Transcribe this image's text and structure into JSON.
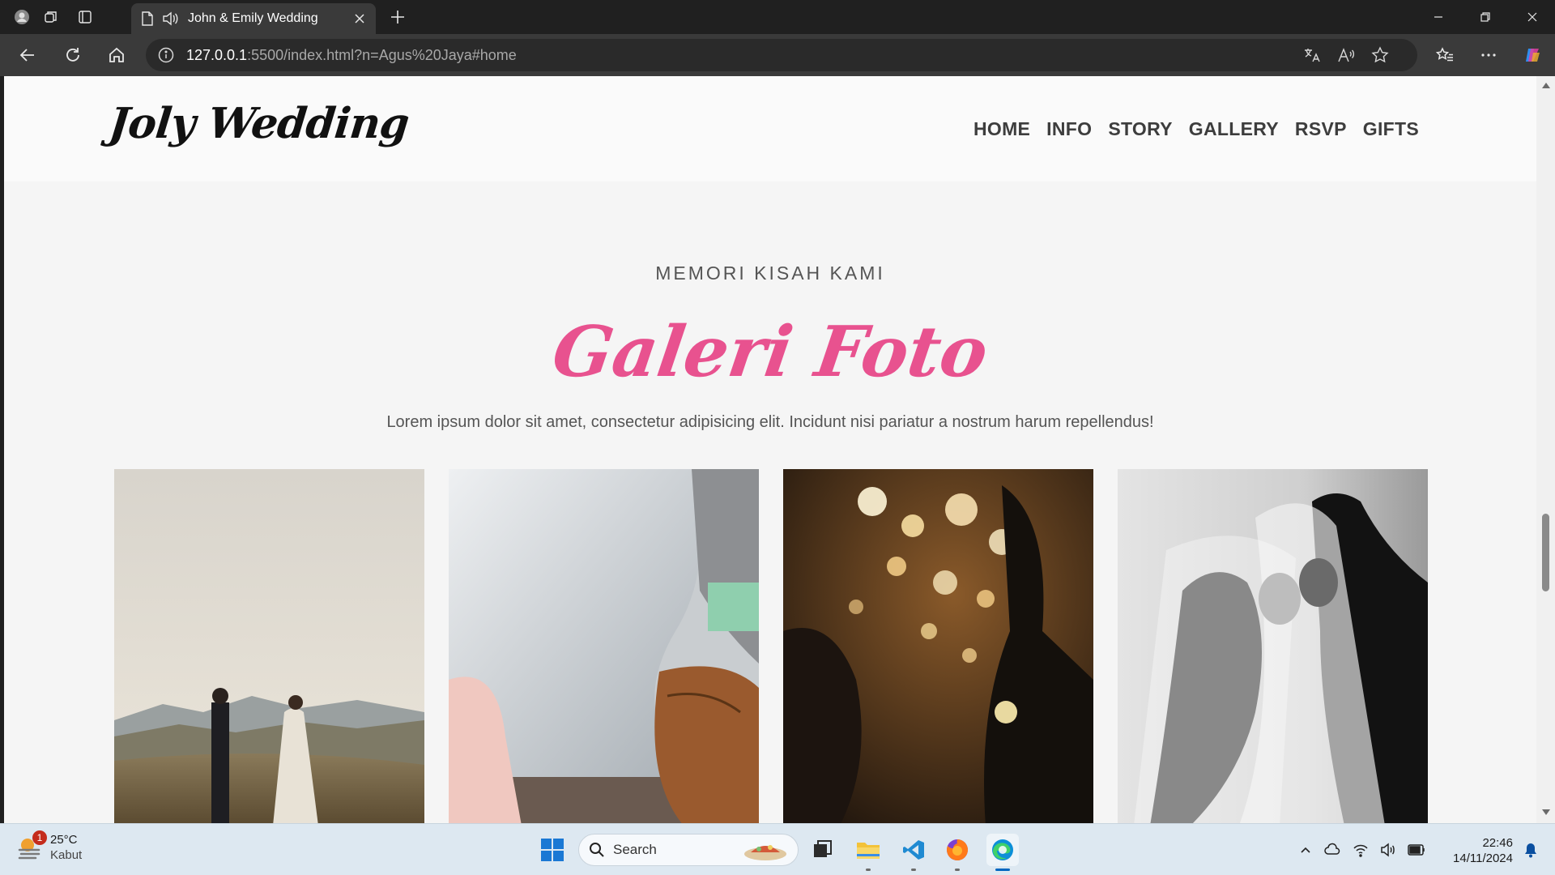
{
  "browser": {
    "tab": {
      "title": "John & Emily Wedding"
    },
    "address": {
      "host": "127.0.0.1",
      "path": ":5500/index.html?n=Agus%20Jaya#home"
    }
  },
  "site": {
    "brand": "Joly Wedding",
    "nav": [
      "HOME",
      "INFO",
      "STORY",
      "GALLERY",
      "RSVP",
      "GIFTS"
    ],
    "gallery": {
      "eyebrow": "MEMORI KISAH KAMI",
      "title": "Galeri Foto",
      "description": "Lorem ipsum dolor sit amet, consectetur adipisicing elit. Incidunt nisi pariatur a nostrum harum repellendus!"
    }
  },
  "taskbar": {
    "weather": {
      "temp": "25°C",
      "condition": "Kabut",
      "badge": "1"
    },
    "search_label": "Search",
    "clock": {
      "time": "22:46",
      "date": "14/11/2024"
    }
  },
  "colors": {
    "accent": "#e8528f",
    "chrome": "#202020",
    "toolbar": "#3a3a3a"
  }
}
